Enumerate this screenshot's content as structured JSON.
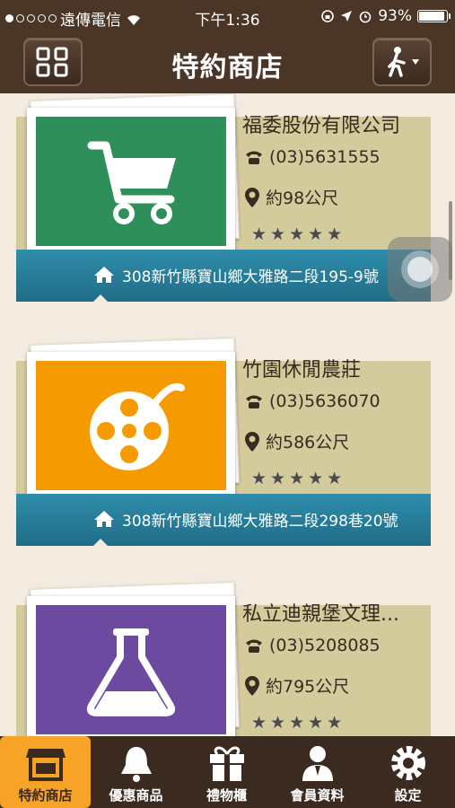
{
  "status_bar": {
    "carrier": "遠傳電信",
    "time": "下午1:36",
    "battery": "93%",
    "battery_level": 0.93
  },
  "nav": {
    "title": "特約商店"
  },
  "stores": [
    {
      "name": "福委股份有限公司",
      "phone": "(03)5631555",
      "distance": "約98公尺",
      "address": "308新竹縣寶山鄉大雅路二段195-9號",
      "image_color": "#2f8f5b",
      "icon": "shopping-cart-icon",
      "rating": 5
    },
    {
      "name": "竹園休閒農莊",
      "phone": "(03)5636070",
      "distance": "約586公尺",
      "address": "308新竹縣寶山鄉大雅路二段298巷20號",
      "image_color": "#f59a00",
      "icon": "film-reel-icon",
      "rating": 5
    },
    {
      "name": "私立迪親堡文理...",
      "phone": "(03)5208085",
      "distance": "約795公尺",
      "address": "",
      "image_color": "#6b4aa0",
      "icon": "flask-icon",
      "rating": 5
    }
  ],
  "tabs": [
    {
      "label": "特約商店",
      "icon": "storefront-icon",
      "active": true
    },
    {
      "label": "優惠商品",
      "icon": "bell-icon",
      "active": false
    },
    {
      "label": "禮物櫃",
      "icon": "gift-icon",
      "active": false
    },
    {
      "label": "會員資料",
      "icon": "user-icon",
      "active": false
    },
    {
      "label": "設定",
      "icon": "gear-icon",
      "active": false
    }
  ]
}
